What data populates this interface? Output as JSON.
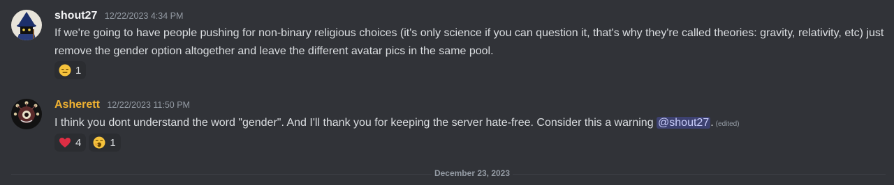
{
  "messages": [
    {
      "username": "shout27",
      "username_color": "#f2f3f5",
      "timestamp": "12/22/2023 4:34 PM",
      "content": "If we're going to have people pushing for non-binary religious choices (it's only science if you can question it, that's why they're called theories: gravity, relativity, etc) just remove the gender option altogether and leave the different avatar pics in the same pool.",
      "reactions": [
        {
          "emoji": "expressionless-face",
          "count": "1"
        }
      ]
    },
    {
      "username": "Asherett",
      "username_color": "#f0b232",
      "timestamp": "12/22/2023 11:50 PM",
      "content_before": "I think you dont understand the word \"gender\". And I'll thank you for keeping the server hate-free. Consider this a warning ",
      "mention": "@shout27",
      "content_after": ".",
      "edited": "(edited)",
      "reactions": [
        {
          "emoji": "red-heart",
          "count": "4"
        },
        {
          "emoji": "yawning-face",
          "count": "1"
        }
      ]
    }
  ],
  "date_divider": "December 23, 2023",
  "colors": {
    "background": "#313338",
    "reaction_bg": "#2b2d31",
    "mention_bg": "#3c4270",
    "timestamp": "#949ba4"
  }
}
